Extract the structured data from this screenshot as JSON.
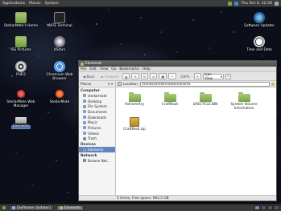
{
  "top_panel": {
    "menus": [
      "Applications",
      "Places",
      "System"
    ],
    "clock": "Thu Oct 4, 22:56"
  },
  "desktop": {
    "icons": [
      {
        "label": "StellarMate's Home",
        "icon": "home-folder-icon"
      },
      {
        "label": "MATE Terminal",
        "icon": "terminal-icon"
      },
      {
        "label": "ISS Pictures",
        "icon": "pictures-folder-icon"
      },
      {
        "label": "KStars",
        "icon": "kstars-icon"
      },
      {
        "label": "PHD2",
        "icon": "phd2-icon"
      },
      {
        "label": "Chromium Web Browser",
        "icon": "chromium-icon"
      },
      {
        "label": "StellarMate Web Manager",
        "icon": "stellarmate-icon"
      },
      {
        "label": "StellarMate",
        "icon": "stellarmate-icon"
      },
      {
        "label": "Elements",
        "icon": "drive-icon"
      },
      {
        "label": "Software Updater",
        "icon": "updater-icon"
      },
      {
        "label": "Time and Date",
        "icon": "clock-icon"
      }
    ]
  },
  "window": {
    "title": "Elements",
    "menu": [
      "File",
      "Edit",
      "View",
      "Go",
      "Bookmarks",
      "Help"
    ],
    "toolbar": {
      "back": "Back",
      "forward": "Forward",
      "zoom": "100%",
      "view_mode": "Icon View"
    },
    "sidebar": {
      "header": "Places",
      "sections": [
        {
          "title": "Computer",
          "items": [
            "stellarmate",
            "Desktop",
            "File System",
            "Documents",
            "Downloads",
            "Music",
            "Pictures",
            "Videos",
            "Trash"
          ]
        },
        {
          "title": "Devices",
          "items": [
            "Elements"
          ]
        },
        {
          "title": "Network",
          "items": [
            "Browse Net..."
          ]
        }
      ]
    },
    "location": {
      "label": "Location:",
      "value": "/media/stellarmate/Elements"
    },
    "files": [
      {
        "name": "Astrometry",
        "type": "folder"
      },
      {
        "name": "CraftRoot",
        "type": "folder"
      },
      {
        "name": "$RECYCLE.BIN",
        "type": "folder"
      },
      {
        "name": "System Volume Information",
        "type": "folder"
      },
      {
        "name": "CraftRoot.zip",
        "type": "zip"
      }
    ],
    "status": "5 items, Free space: 983.5 GB"
  },
  "bottom_panel": {
    "tasks": [
      "[Software Updater]",
      "Elements"
    ]
  }
}
